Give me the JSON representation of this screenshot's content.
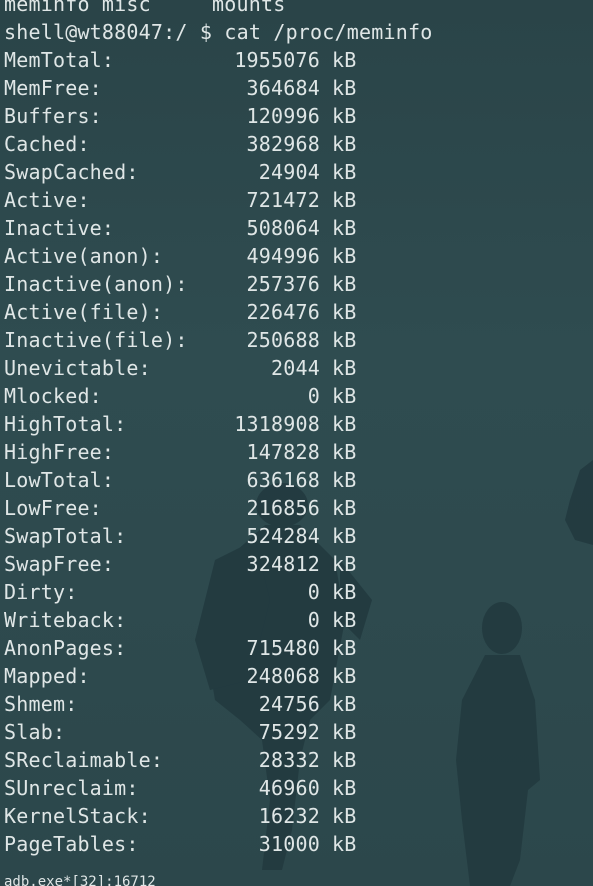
{
  "top_line": {
    "left": "meminfo misc",
    "right": "mounts"
  },
  "prompt": {
    "user_host_path": "shell@wt88047:/ $",
    "command": "cat /proc/meminfo"
  },
  "meminfo": [
    {
      "key": "MemTotal:",
      "value": "1955076",
      "unit": "kB"
    },
    {
      "key": "MemFree:",
      "value": "364684",
      "unit": "kB"
    },
    {
      "key": "Buffers:",
      "value": "120996",
      "unit": "kB"
    },
    {
      "key": "Cached:",
      "value": "382968",
      "unit": "kB"
    },
    {
      "key": "SwapCached:",
      "value": "24904",
      "unit": "kB"
    },
    {
      "key": "Active:",
      "value": "721472",
      "unit": "kB"
    },
    {
      "key": "Inactive:",
      "value": "508064",
      "unit": "kB"
    },
    {
      "key": "Active(anon):",
      "value": "494996",
      "unit": "kB"
    },
    {
      "key": "Inactive(anon):",
      "value": "257376",
      "unit": "kB"
    },
    {
      "key": "Active(file):",
      "value": "226476",
      "unit": "kB"
    },
    {
      "key": "Inactive(file):",
      "value": "250688",
      "unit": "kB"
    },
    {
      "key": "Unevictable:",
      "value": "2044",
      "unit": "kB"
    },
    {
      "key": "Mlocked:",
      "value": "0",
      "unit": "kB"
    },
    {
      "key": "HighTotal:",
      "value": "1318908",
      "unit": "kB"
    },
    {
      "key": "HighFree:",
      "value": "147828",
      "unit": "kB"
    },
    {
      "key": "LowTotal:",
      "value": "636168",
      "unit": "kB"
    },
    {
      "key": "LowFree:",
      "value": "216856",
      "unit": "kB"
    },
    {
      "key": "SwapTotal:",
      "value": "524284",
      "unit": "kB"
    },
    {
      "key": "SwapFree:",
      "value": "324812",
      "unit": "kB"
    },
    {
      "key": "Dirty:",
      "value": "0",
      "unit": "kB"
    },
    {
      "key": "Writeback:",
      "value": "0",
      "unit": "kB"
    },
    {
      "key": "AnonPages:",
      "value": "715480",
      "unit": "kB"
    },
    {
      "key": "Mapped:",
      "value": "248068",
      "unit": "kB"
    },
    {
      "key": "Shmem:",
      "value": "24756",
      "unit": "kB"
    },
    {
      "key": "Slab:",
      "value": "75292",
      "unit": "kB"
    },
    {
      "key": "SReclaimable:",
      "value": "28332",
      "unit": "kB"
    },
    {
      "key": "SUnreclaim:",
      "value": "46960",
      "unit": "kB"
    },
    {
      "key": "KernelStack:",
      "value": "16232",
      "unit": "kB"
    },
    {
      "key": "PageTables:",
      "value": "31000",
      "unit": "kB"
    }
  ],
  "status_bar": "adb.exe*[32]:16712",
  "colors": {
    "background": "#2e4a4e",
    "text": "#dfe6e6",
    "silhouette": "#223a3f"
  }
}
